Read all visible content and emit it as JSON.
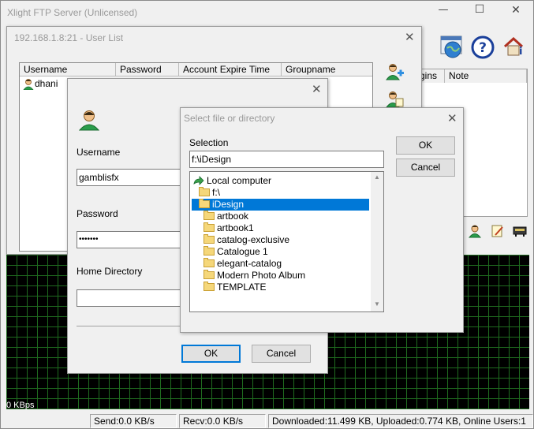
{
  "main_window": {
    "title": "Xlight FTP Server (Unlicensed)",
    "minimize": "—",
    "maximize": "☐",
    "close": "✕",
    "columns": [
      "gins",
      "Note"
    ],
    "speed_label": "0 KBps"
  },
  "status_bar": {
    "send": "Send:0.0 KB/s",
    "recv": "Recv:0.0 KB/s",
    "summary": "Downloaded:11.499 KB, Uploaded:0.774 KB, Online Users:1"
  },
  "user_list": {
    "title": "192.168.1.8:21 - User List",
    "close": "✕",
    "columns": [
      "Username",
      "Password",
      "Account Expire Time",
      "Groupname"
    ],
    "rows": [
      {
        "username": "dhani"
      }
    ]
  },
  "user_dialog": {
    "close": "✕",
    "username_label": "Username",
    "username_value": "gamblisfx",
    "password_label": "Password",
    "password_value": "•••••••",
    "home_label": "Home Directory",
    "home_value": "",
    "ok": "OK",
    "cancel": "Cancel"
  },
  "file_dialog": {
    "title": "Select file or directory",
    "close": "✕",
    "selection_label": "Selection",
    "selection_value": "f:\\iDesign",
    "ok": "OK",
    "cancel": "Cancel",
    "tree": [
      {
        "label": "Local computer",
        "type": "computer",
        "level": 0
      },
      {
        "label": "f:\\",
        "type": "folder-open",
        "level": 1
      },
      {
        "label": "iDesign",
        "type": "folder-open",
        "level": 1,
        "selected": true
      },
      {
        "label": "artbook",
        "type": "folder",
        "level": 2
      },
      {
        "label": "artbook1",
        "type": "folder",
        "level": 2
      },
      {
        "label": "catalog-exclusive",
        "type": "folder",
        "level": 2
      },
      {
        "label": "Catalogue 1",
        "type": "folder",
        "level": 2
      },
      {
        "label": "elegant-catalog",
        "type": "folder",
        "level": 2
      },
      {
        "label": "Modern Photo Album",
        "type": "folder",
        "level": 2
      },
      {
        "label": "TEMPLATE",
        "type": "folder",
        "level": 2
      }
    ]
  },
  "colors": {
    "selection": "#0078d7",
    "grid_bg": "#000000",
    "grid_line": "#1f6b1f"
  }
}
